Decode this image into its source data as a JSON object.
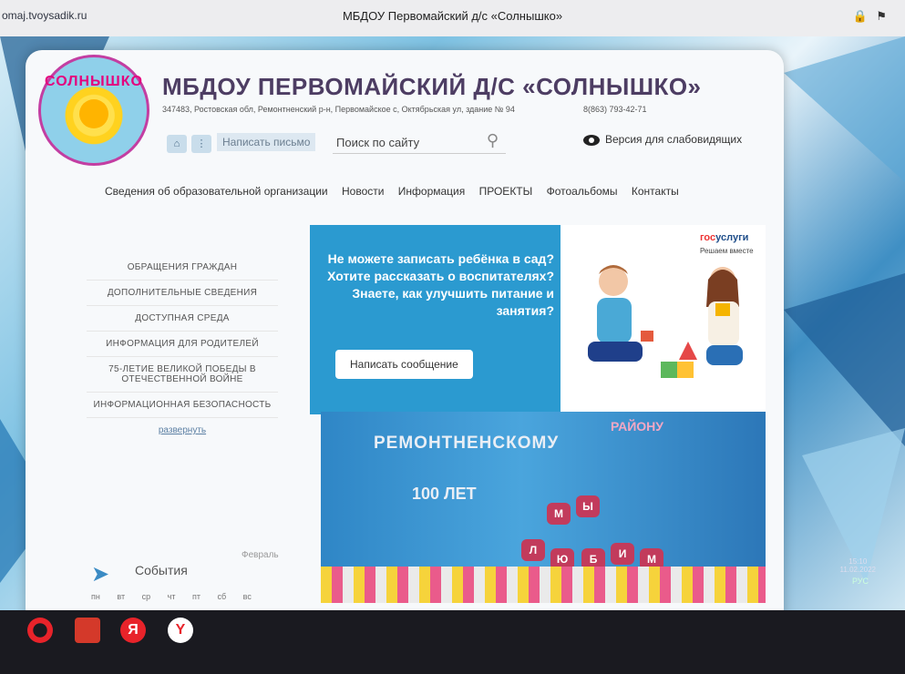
{
  "browser": {
    "url": "omaj.tvoysadik.ru",
    "tab_title": "МБДОУ Первомайский д/с «Солнышко»"
  },
  "header": {
    "logo_text": "СОЛНЫШКО",
    "site_title": "МБДОУ ПЕРВОМАЙСКИЙ Д/С «СОЛНЫШКО»",
    "address": "347483, Ростовская обл, Ремонтненский р-н, Первомайское с, Октябрьская ул, здание № 94",
    "phone": "8(863) 793-42-71",
    "write_letter": "Написать письмо",
    "search_placeholder": "Поиск по сайту",
    "low_vision": "Версия для слабовидящих"
  },
  "nav": [
    "Сведения об образовательной организации",
    "Новости",
    "Информация",
    "ПРОЕКТЫ",
    "Фотоальбомы",
    "Контакты"
  ],
  "sidebar": {
    "items": [
      "Обращения граждан",
      "Дополнительные сведения",
      "Доступная среда",
      "Информация для родителей",
      "75-летие великой победы в отечественной войне",
      "Информационная безопасность"
    ],
    "expand": "развернуть"
  },
  "events": {
    "title": "События",
    "month": "Февраль",
    "weekdays": [
      "пн",
      "вт",
      "ср",
      "чт",
      "пт",
      "сб",
      "вс"
    ]
  },
  "banner": {
    "text": "Не можете записать ребёнка в сад? Хотите рассказать о воспитателях? Знаете, как улучшить питание и занятия?",
    "button": "Написать сообщение",
    "gos_a": "гос",
    "gos_b": "услуги",
    "gos_tagline": "Решаем вместе",
    "accent": "#2b9ad0"
  },
  "photo": {
    "title": "РЕМОНТНЕНСКОМУ",
    "subtitle": "100 ЛЕТ",
    "vertical": "РАЙОНУ",
    "hearts_top": [
      "М",
      "Ы"
    ],
    "hearts_bottom": [
      "Л",
      "Ю",
      "Б",
      "И",
      "М"
    ]
  },
  "taskbar": {
    "tray": "РУС",
    "time": "15:10",
    "date": "11.02.2022"
  }
}
